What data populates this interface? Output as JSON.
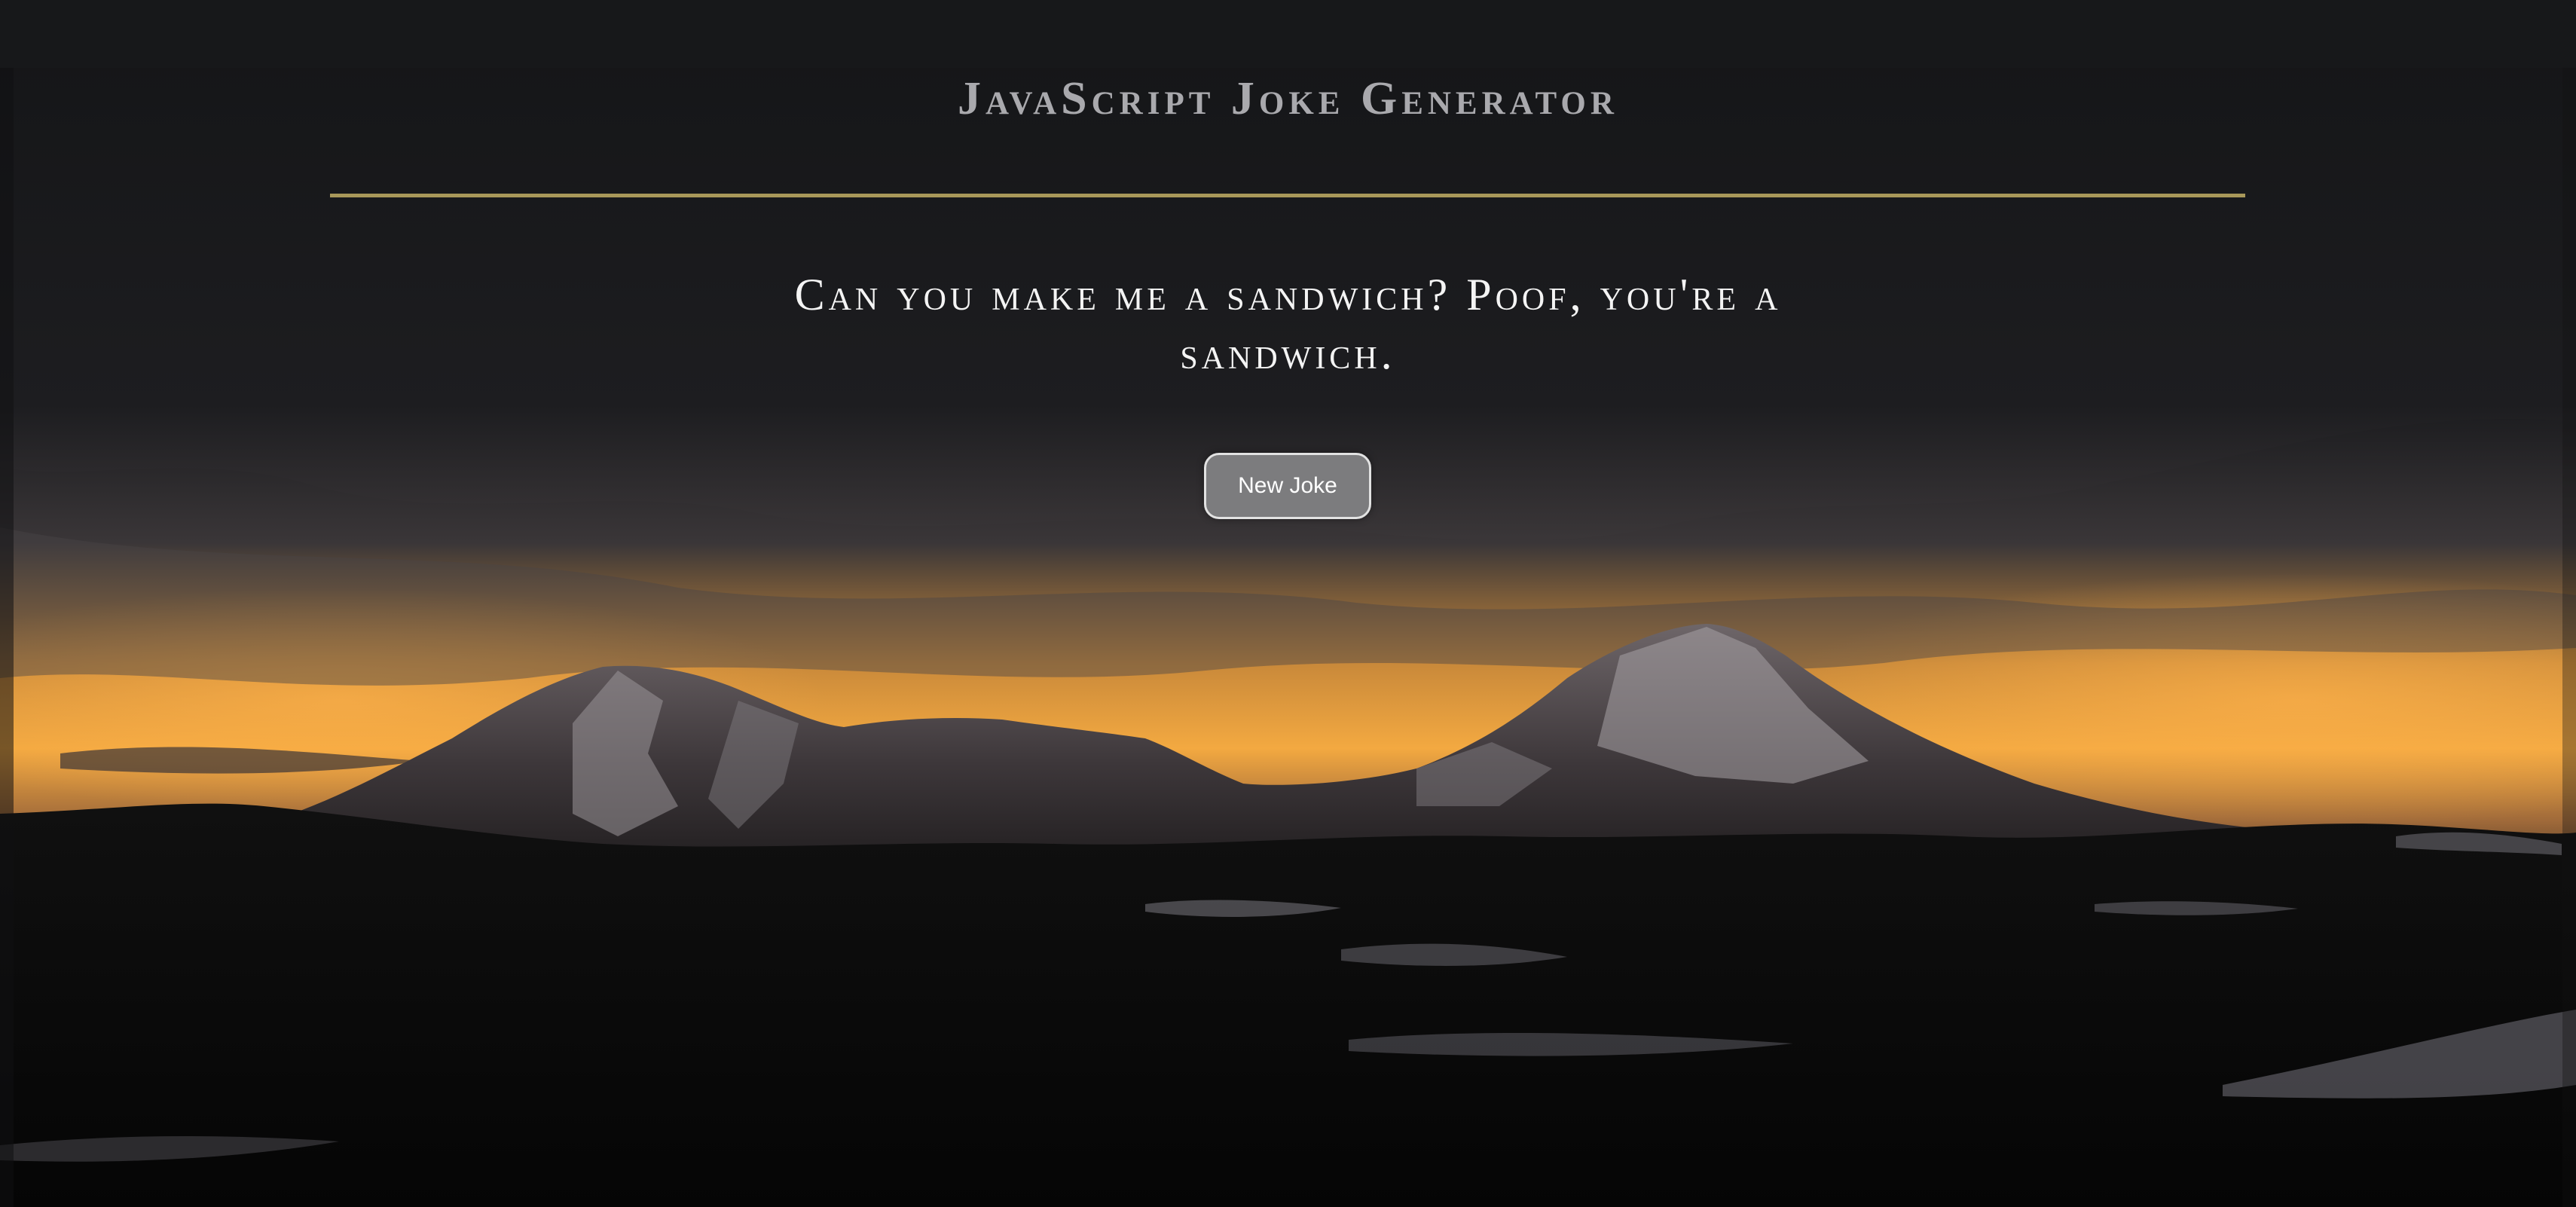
{
  "app": {
    "title": "JavaScript Joke Generator"
  },
  "joke": {
    "text": "Can you make me a sandwich? Poof, you're a sandwich."
  },
  "controls": {
    "new_joke_label": "New Joke"
  },
  "background": {
    "subject": "mountain-landscape-at-sunset",
    "colors": {
      "sky_dark": "#18191c",
      "sunset_glow": "#f1a640",
      "mountain_shadow": "#2a2628",
      "snow": "#8e8a8e",
      "forest": "#070707"
    }
  },
  "colors": {
    "title": "#a9a9ad",
    "divider": "#a8985a",
    "joke_text": "#f4f4f4",
    "button_bg": "#7c7c7e",
    "button_border": "#e2e2e2"
  }
}
